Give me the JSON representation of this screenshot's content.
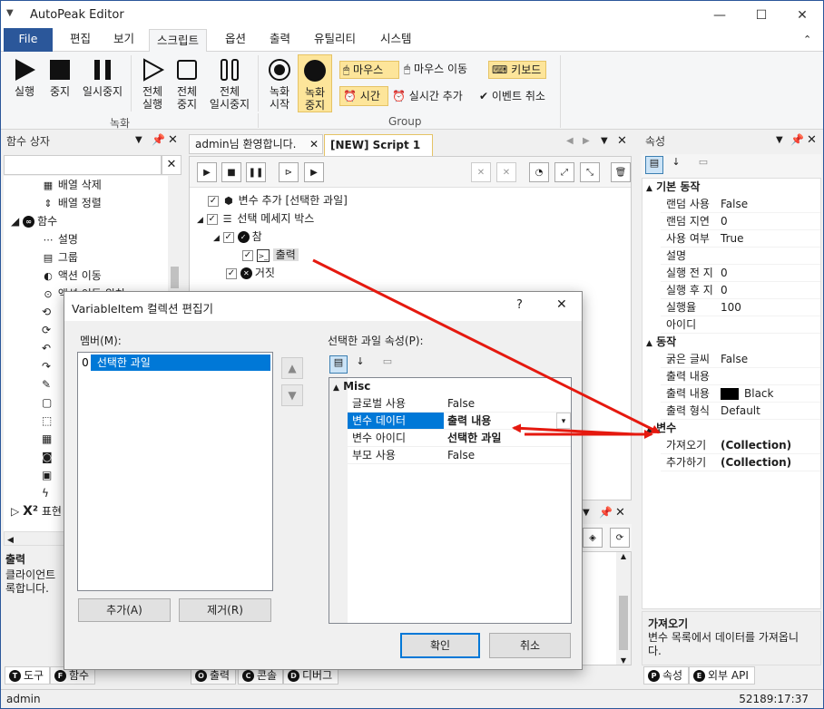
{
  "window": {
    "title": "AutoPeak Editor"
  },
  "ribbon": {
    "tabs": [
      "File",
      "편집",
      "보기",
      "스크립트",
      "옵션",
      "출력",
      "유틸리티",
      "시스템"
    ],
    "active_tab": "스크립트",
    "buttons": {
      "run": "실행",
      "stop": "중지",
      "pause": "일시중지",
      "all_run": "전체\n실행",
      "all_stop": "전체\n중지",
      "all_pause": "전체\n일시중지",
      "rec_start": "녹화\n시작",
      "rec_stop": "녹화\n중지",
      "mouse": "마우스",
      "mouse_move": "마우스 이동",
      "keyboard": "키보드",
      "time": "시간",
      "realtime_add": "실시간 추가",
      "event_cancel": "이벤트 취소"
    },
    "groups": {
      "record": "녹화",
      "group": "Group"
    }
  },
  "left_panel": {
    "title": "함수 상자",
    "items": [
      "배열 삭제",
      "배열 정렬",
      "함수",
      "설명",
      "그룹",
      "액션 이동",
      "액션 이동 위치"
    ],
    "bottom_item": "표현",
    "desc_title": "출력",
    "desc_text": "클라이언트에 출력합니다.",
    "desc_line1": "클라이언트",
    "desc_line2": "록합니다.",
    "tabs": [
      "도구",
      "함수"
    ]
  },
  "editor": {
    "tabs": [
      "admin님 환영합니다.",
      "[NEW] Script 1"
    ],
    "tree": [
      {
        "label": "변수 추가 [선택한 과일]"
      },
      {
        "label": "선택 메세지 박스"
      },
      {
        "label": "참"
      },
      {
        "label": "출력"
      },
      {
        "label": "거짓"
      }
    ]
  },
  "output_panel": {
    "tabs": [
      "출력",
      "콘솔",
      "디버그"
    ]
  },
  "properties": {
    "title": "속성",
    "categories": [
      {
        "name": "기본 동작",
        "rows": [
          {
            "key": "랜덤 사용",
            "value": "False"
          },
          {
            "key": "랜덤 지연",
            "value": "0"
          },
          {
            "key": "사용 여부",
            "value": "True"
          },
          {
            "key": "설명",
            "value": ""
          },
          {
            "key": "실행 전 지",
            "value": "0"
          },
          {
            "key": "실행 후 지",
            "value": "0"
          },
          {
            "key": "실행율",
            "value": "100"
          },
          {
            "key": "아이디",
            "value": ""
          }
        ]
      },
      {
        "name": "동작",
        "rows": [
          {
            "key": "굵은 글씨",
            "value": "False"
          },
          {
            "key": "출력 내용",
            "value": ""
          },
          {
            "key": "출력 내용",
            "value": "Black"
          },
          {
            "key": "출력 형식",
            "value": "Default"
          }
        ]
      },
      {
        "name": "변수",
        "rows": [
          {
            "key": "가져오기",
            "value": "(Collection)"
          },
          {
            "key": "추가하기",
            "value": "(Collection)"
          }
        ]
      }
    ],
    "help_title": "가져오기",
    "help_text": "변수 목록에서 데이터를 가져옵니다.",
    "help_line1": "변수 목록에서 데이터를 가져옵니",
    "help_line2": "다.",
    "tabs": [
      "속성",
      "외부 API"
    ]
  },
  "dialog": {
    "title": "VariableItem 컬렉션 편집기",
    "help_btn": "?",
    "members_label": "멤버(M):",
    "members": [
      {
        "index": "0",
        "name": "선택한 과일"
      }
    ],
    "props_label": "선택한 과일 속성(P):",
    "misc_label": "Misc",
    "props": [
      {
        "key": "글로벌 사용",
        "value": "False"
      },
      {
        "key": "변수 데이터",
        "value": "출력 내용"
      },
      {
        "key": "변수 아이디",
        "value": "선택한 과일"
      },
      {
        "key": "부모 사용",
        "value": "False"
      }
    ],
    "add_btn": "추가(A)",
    "remove_btn": "제거(R)",
    "ok_btn": "확인",
    "cancel_btn": "취소"
  },
  "status": {
    "user": "admin",
    "time": "52189:17:37"
  },
  "colors": {
    "accent": "#2b579a",
    "highlight": "#0078d7",
    "arrow": "#e5190f",
    "record_hl": "#fde59a"
  }
}
